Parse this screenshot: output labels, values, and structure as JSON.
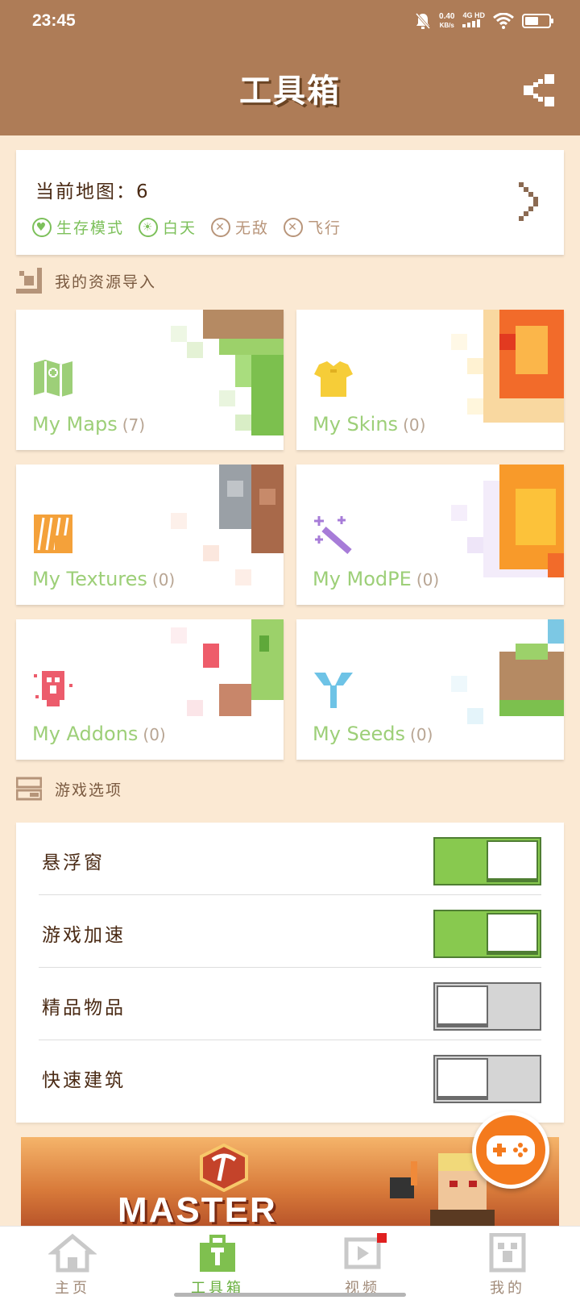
{
  "status_bar": {
    "time": "23:45",
    "net_speed": "0.40",
    "net_unit": "KB/s",
    "network": "4G HD"
  },
  "header": {
    "title": "工具箱"
  },
  "map_card": {
    "title": "当前地图：6",
    "tags": [
      {
        "label": "生存模式",
        "state": "on",
        "icon": "heart-icon"
      },
      {
        "label": "白天",
        "state": "on",
        "icon": "sun-icon"
      },
      {
        "label": "无敌",
        "state": "off",
        "icon": "x-icon"
      },
      {
        "label": "飞行",
        "state": "off",
        "icon": "x-icon"
      }
    ]
  },
  "resources": {
    "heading": "我的资源导入",
    "items": [
      {
        "label": "My Maps",
        "count": "(7)"
      },
      {
        "label": "My Skins",
        "count": "(0)"
      },
      {
        "label": "My Textures",
        "count": "(0)"
      },
      {
        "label": "My ModPE",
        "count": "(0)"
      },
      {
        "label": "My Addons",
        "count": "(0)"
      },
      {
        "label": "My Seeds",
        "count": "(0)"
      }
    ]
  },
  "options": {
    "heading": "游戏选项",
    "items": [
      {
        "label": "悬浮窗",
        "enabled": true
      },
      {
        "label": "游戏加速",
        "enabled": true
      },
      {
        "label": "精品物品",
        "enabled": false
      },
      {
        "label": "快速建筑",
        "enabled": false
      }
    ]
  },
  "banner": {
    "title": "MASTER"
  },
  "nav": {
    "items": [
      {
        "label": "主页",
        "active": false
      },
      {
        "label": "工具箱",
        "active": true
      },
      {
        "label": "视频",
        "active": false
      },
      {
        "label": "我的",
        "active": false
      }
    ]
  },
  "colors": {
    "header": "#ae7c57",
    "background": "#fbe9d3",
    "accent_green": "#88c94f",
    "fab_orange": "#f47a1d"
  }
}
